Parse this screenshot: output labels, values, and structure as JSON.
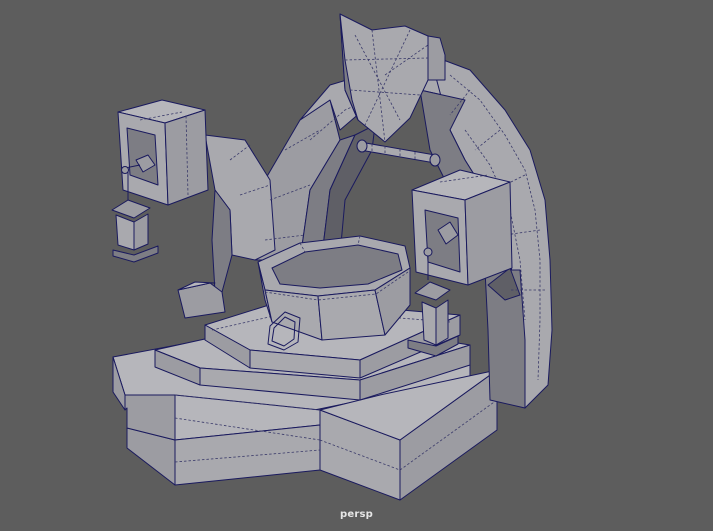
{
  "viewport": {
    "camera_label": "persp",
    "background_color": "#5d5d5d",
    "wire_color": "#1a1a5e",
    "shaded_color": "#a4a4aa"
  },
  "scene": {
    "objects": [
      "shield-emblem",
      "stone-arch",
      "wooden-axle",
      "left-lantern-post",
      "right-lantern-post",
      "left-hanging-lantern",
      "right-lantern",
      "octagonal-basin",
      "basin-ring-handle",
      "stepped-base-platform"
    ]
  }
}
